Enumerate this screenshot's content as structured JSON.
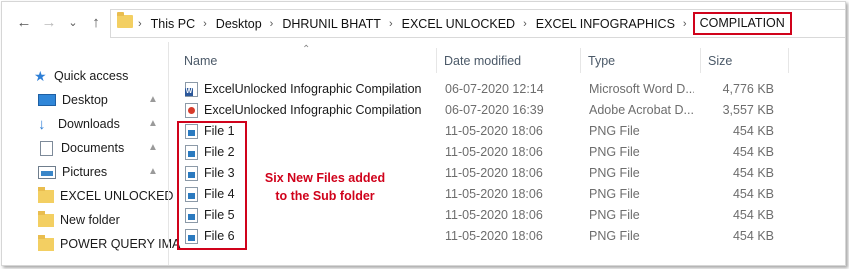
{
  "breadcrumb": [
    "This PC",
    "Desktop",
    "DHRUNIL BHATT",
    "EXCEL UNLOCKED",
    "EXCEL INFOGRAPHICS",
    "COMPILATION"
  ],
  "sidebar": {
    "items": [
      {
        "label": "Quick access",
        "icon": "star-icon",
        "pinned": false
      },
      {
        "label": "Desktop",
        "icon": "desktop-icon",
        "pinned": true
      },
      {
        "label": "Downloads",
        "icon": "download-icon",
        "pinned": true
      },
      {
        "label": "Documents",
        "icon": "document-icon",
        "pinned": true
      },
      {
        "label": "Pictures",
        "icon": "picture-icon",
        "pinned": true
      },
      {
        "label": "EXCEL UNLOCKED",
        "icon": "folder-icon",
        "pinned": false
      },
      {
        "label": "New folder",
        "icon": "folder-icon",
        "pinned": false
      },
      {
        "label": "POWER QUERY IMA",
        "icon": "folder-icon",
        "pinned": false
      }
    ]
  },
  "columns": {
    "name": "Name",
    "date": "Date modified",
    "type": "Type",
    "size": "Size"
  },
  "files": [
    {
      "name": "ExcelUnlocked Infographic Compilation ...",
      "date": "06-07-2020 12:14",
      "type": "Microsoft Word D...",
      "size": "4,776 KB",
      "icon": "word-file-icon"
    },
    {
      "name": "ExcelUnlocked Infographic Compilation ...",
      "date": "06-07-2020 16:39",
      "type": "Adobe Acrobat D...",
      "size": "3,557 KB",
      "icon": "pdf-file-icon"
    },
    {
      "name": "File 1",
      "date": "11-05-2020 18:06",
      "type": "PNG File",
      "size": "454 KB",
      "icon": "png-file-icon"
    },
    {
      "name": "File 2",
      "date": "11-05-2020 18:06",
      "type": "PNG File",
      "size": "454 KB",
      "icon": "png-file-icon"
    },
    {
      "name": "File 3",
      "date": "11-05-2020 18:06",
      "type": "PNG File",
      "size": "454 KB",
      "icon": "png-file-icon"
    },
    {
      "name": "File 4",
      "date": "11-05-2020 18:06",
      "type": "PNG File",
      "size": "454 KB",
      "icon": "png-file-icon"
    },
    {
      "name": "File 5",
      "date": "11-05-2020 18:06",
      "type": "PNG File",
      "size": "454 KB",
      "icon": "png-file-icon"
    },
    {
      "name": "File 6",
      "date": "11-05-2020 18:06",
      "type": "PNG File",
      "size": "454 KB",
      "icon": "png-file-icon"
    }
  ],
  "annotation": {
    "line1": "Six New Files added",
    "line2": "to the Sub folder"
  },
  "colors": {
    "highlight": "#d0021b",
    "folder": "#f3cf62",
    "accent": "#2f7fd6"
  }
}
